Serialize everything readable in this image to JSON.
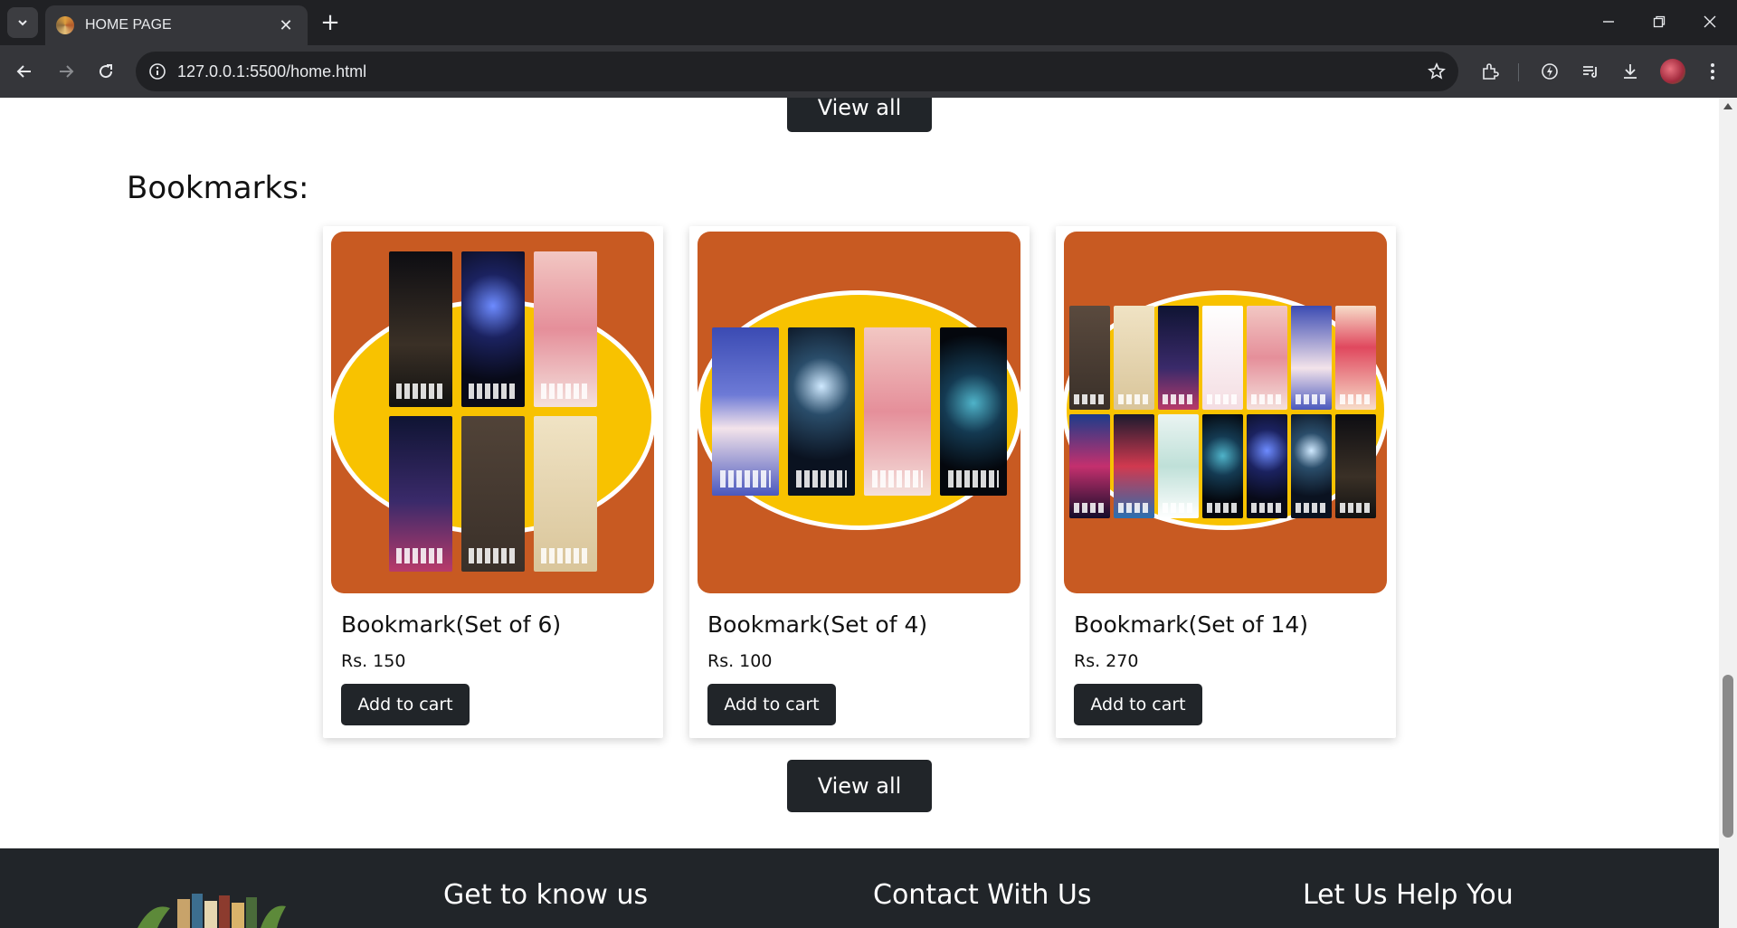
{
  "browser": {
    "tab_title": "HOME PAGE",
    "url": "127.0.0.1:5500/home.html"
  },
  "page": {
    "view_all_top": "View all",
    "section_title": "Bookmarks:",
    "products": [
      {
        "name": "Bookmark(Set of 6)",
        "price": "Rs. 150",
        "button": "Add to cart"
      },
      {
        "name": "Bookmark(Set of 4)",
        "price": "Rs. 100",
        "button": "Add to cart"
      },
      {
        "name": "Bookmark(Set of 14)",
        "price": "Rs. 270",
        "button": "Add to cart"
      }
    ],
    "view_all_bottom": "View all"
  },
  "footer": {
    "headings": [
      "Get to know us",
      "Contact With Us",
      "Let Us Help You"
    ]
  },
  "colors": {
    "chrome_dark": "#202124",
    "chrome_toolbar": "#35363a",
    "button_dark": "#212529",
    "product_background": "#c85a22",
    "ellipse_yellow": "#f8c200"
  }
}
